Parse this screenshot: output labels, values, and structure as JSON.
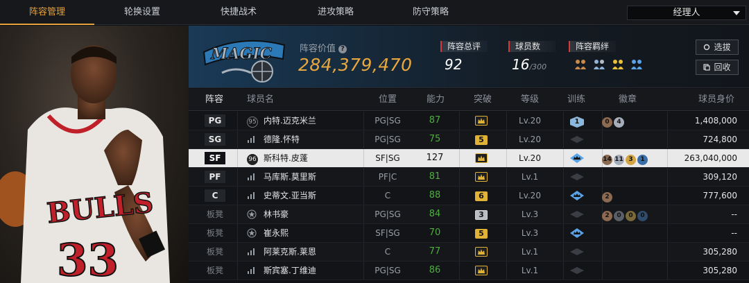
{
  "nav": {
    "tabs": [
      {
        "label": "阵容管理",
        "active": true
      },
      {
        "label": "轮换设置",
        "active": false
      },
      {
        "label": "快捷战术",
        "active": false
      },
      {
        "label": "进攻策略",
        "active": false
      },
      {
        "label": "防守策略",
        "active": false
      }
    ],
    "role_select": "经理人"
  },
  "header": {
    "team_logo_name": "magic-logo",
    "value_label": "阵容价值",
    "value": "284,379,470",
    "overall_label": "阵容总评",
    "overall": "92",
    "players_label": "球员数",
    "players_count": "16",
    "players_max": "/300",
    "bond_label": "阵容羁绊",
    "bond_icons": [
      "bond-icon-bronze",
      "bond-icon-blue",
      "bond-icon-gold",
      "bond-icon-blue-2"
    ],
    "pick_button": "选拔",
    "recycle_button": "回收"
  },
  "table": {
    "headers": [
      "阵容",
      "球员名",
      "位置",
      "能力",
      "突破",
      "等级",
      "训练",
      "徽章",
      "球员身价"
    ],
    "rows": [
      {
        "slot": "PG",
        "icon": "95",
        "name": "内特.迈克米兰",
        "position": "PG|SG",
        "ability": "87",
        "breakthrough": "crown",
        "level": "Lv.20",
        "training": "1",
        "badges": [
          "0",
          "4"
        ],
        "price": "1,408,000"
      },
      {
        "slot": "SG",
        "icon": "bars",
        "name": "德隆.怀特",
        "position": "PG|SG",
        "ability": "75",
        "breakthrough": "5",
        "level": "Lv.20",
        "training": "",
        "badges": [],
        "price": "724,800"
      },
      {
        "slot": "SF",
        "icon": "96",
        "name": "斯科特.皮蓬",
        "position": "SF|SG",
        "ability": "127",
        "breakthrough": "crown",
        "level": "Lv.20",
        "training": "crown",
        "badges": [
          "14",
          "11",
          "3",
          "1"
        ],
        "price": "263,040,000",
        "selected": true
      },
      {
        "slot": "PF",
        "icon": "bars",
        "name": "马库斯.莫里斯",
        "position": "PF|C",
        "ability": "81",
        "breakthrough": "crown",
        "level": "Lv.1",
        "training": "",
        "badges": [],
        "price": "309,120"
      },
      {
        "slot": "C",
        "icon": "bars",
        "name": "史蒂文.亚当斯",
        "position": "C",
        "ability": "88",
        "breakthrough": "6",
        "level": "Lv.20",
        "training": "crown",
        "badges": [
          "2"
        ],
        "price": "777,600"
      },
      {
        "slot": "板凳",
        "icon": "star",
        "name": "林书豪",
        "position": "PG|SG",
        "ability": "84",
        "breakthrough": "3",
        "level": "Lv.3",
        "training": "",
        "badges": [
          "2",
          "0",
          "0",
          "0"
        ],
        "price": "--"
      },
      {
        "slot": "板凳",
        "icon": "star",
        "name": "崔永熙",
        "position": "SF|SG",
        "ability": "70",
        "breakthrough": "5",
        "level": "Lv.3",
        "training": "crown",
        "badges": [],
        "price": "--"
      },
      {
        "slot": "板凳",
        "icon": "bars",
        "name": "阿莱克斯.莱恩",
        "position": "C",
        "ability": "77",
        "breakthrough": "crown",
        "level": "Lv.1",
        "training": "",
        "badges": [],
        "price": "305,280"
      },
      {
        "slot": "板凳",
        "icon": "bars",
        "name": "斯宾塞.丁维迪",
        "position": "PG|SG",
        "ability": "86",
        "breakthrough": "crown",
        "level": "Lv.1",
        "training": "",
        "badges": [],
        "price": "305,280"
      }
    ]
  },
  "photo": {
    "jersey_text": "BULLS",
    "jersey_number": "33"
  },
  "colors": {
    "accent": "#e7a23a",
    "ability_green": "#4fae3f",
    "gold": "#e0b236"
  }
}
